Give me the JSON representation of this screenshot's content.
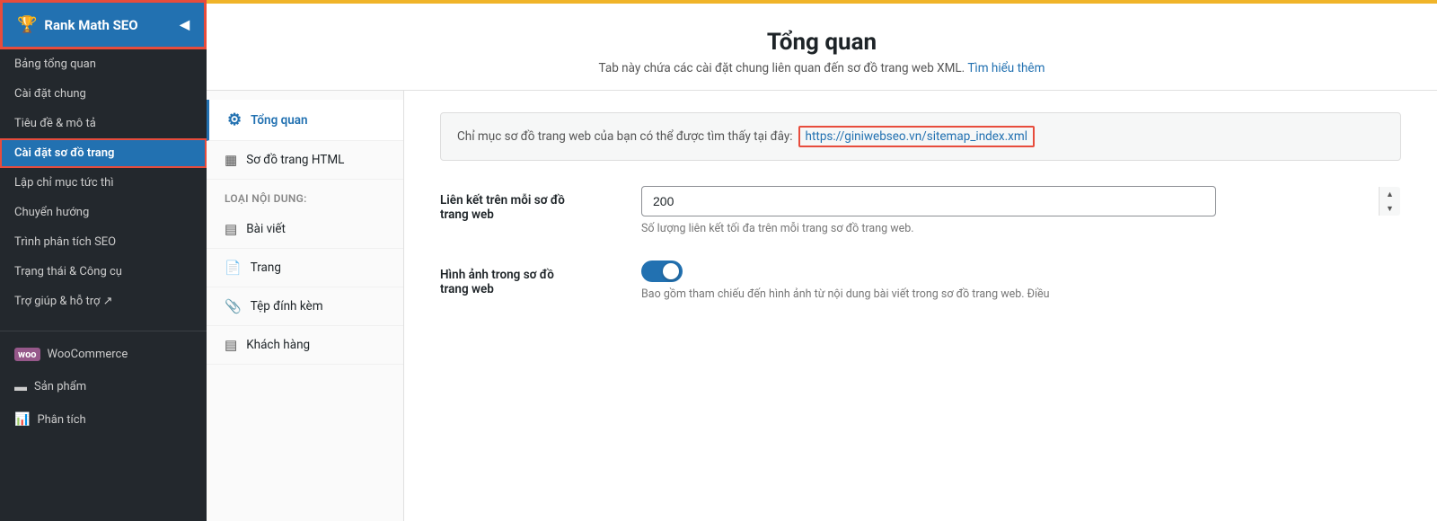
{
  "sidebar": {
    "rank_math_label": "Rank Math SEO",
    "items": [
      {
        "id": "bang-tong-quan",
        "label": "Bảng tổng quan"
      },
      {
        "id": "cai-dat-chung",
        "label": "Cài đặt chung"
      },
      {
        "id": "tieu-de-mo-ta",
        "label": "Tiêu đề & mô tả"
      },
      {
        "id": "cai-dat-so-do-trang",
        "label": "Cài đặt sơ đồ trang",
        "active": true
      },
      {
        "id": "lap-chi-muc-tuc-thi",
        "label": "Lập chỉ mục tức thì"
      },
      {
        "id": "chuyen-huong",
        "label": "Chuyển hướng"
      },
      {
        "id": "trinh-phan-tich-seo",
        "label": "Trình phân tích SEO"
      },
      {
        "id": "trang-thai-cong-cu",
        "label": "Trạng thái & Công cụ"
      },
      {
        "id": "tro-giup",
        "label": "Trợ giúp & hỗ trợ ↗"
      }
    ],
    "extra_items": [
      {
        "id": "woocommerce",
        "label": "WooCommerce",
        "icon": "🛒"
      },
      {
        "id": "san-pham",
        "label": "Sản phẩm",
        "icon": "▬"
      },
      {
        "id": "phan-tich",
        "label": "Phân tích",
        "icon": "📊"
      }
    ]
  },
  "page": {
    "title": "Tổng quan",
    "subtitle": "Tab này chứa các cài đặt chung liên quan đến sơ đồ trang web XML.",
    "learn_more": "Tìm hiểu thêm"
  },
  "tabs": {
    "active": "tong-quan",
    "items": [
      {
        "id": "tong-quan",
        "label": "Tổng quan",
        "icon": "⚙"
      },
      {
        "id": "so-do-trang-html",
        "label": "Sơ đồ trang HTML",
        "icon": "▦"
      }
    ],
    "section_label": "Loại nội dung:",
    "content_types": [
      {
        "id": "bai-viet",
        "label": "Bài viết",
        "icon": "▤"
      },
      {
        "id": "trang",
        "label": "Trang",
        "icon": "📄"
      },
      {
        "id": "tep-dinh-kem",
        "label": "Tệp đính kèm",
        "icon": "📎"
      },
      {
        "id": "khach-hang",
        "label": "Khách hàng",
        "icon": "▤"
      }
    ]
  },
  "sitemap": {
    "index_text": "Chỉ mục sơ đồ trang web của bạn có thể được tìm thấy tại đây:",
    "index_url": "https://giniwebseo.vn/sitemap_index.xml"
  },
  "fields": {
    "links_per_sitemap": {
      "label": "Liên kết trên mỗi sơ đồ\ntrang web",
      "value": "200",
      "help": "Số lượng liên kết tối đa trên mỗi trang sơ đồ trang web."
    },
    "images_in_sitemap": {
      "label": "Hình ảnh trong sơ đồ\ntrang web",
      "help": "Bao gồm tham chiếu đến hình ảnh từ nội dung bài viết trong sơ đồ trang web. Điều"
    }
  },
  "icons": {
    "chevron_up": "▲",
    "chevron_down": "▼",
    "arrow_left": "◀"
  }
}
